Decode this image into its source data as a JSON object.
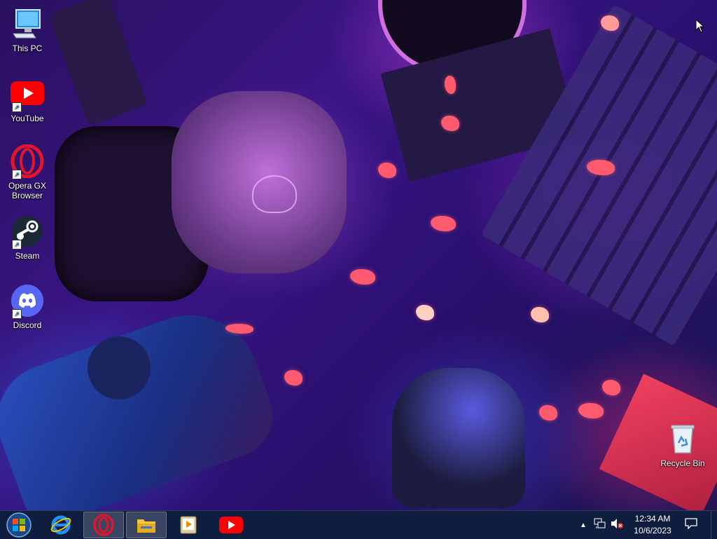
{
  "desktop": {
    "icons": [
      {
        "label": "This PC",
        "icon": "this-pc-icon"
      },
      {
        "label": "YouTube",
        "icon": "youtube-icon"
      },
      {
        "label": "Opera GX Browser",
        "icon": "opera-gx-icon"
      },
      {
        "label": "Steam",
        "icon": "steam-icon"
      },
      {
        "label": "Discord",
        "icon": "discord-icon"
      },
      {
        "label": "Recycle Bin",
        "icon": "recycle-bin-icon"
      }
    ]
  },
  "taskbar": {
    "items": [
      "start-button",
      "internet-explorer-icon",
      "opera-gx-icon",
      "file-explorer-icon",
      "media-player-icon",
      "youtube-icon"
    ],
    "time": "12:34 AM",
    "date": "10/6/2023"
  },
  "colors": {
    "taskbar": "#0f1d3f",
    "youtube_red": "#ff0000",
    "discord_blurple": "#5865f2",
    "opera_red": "#e1162c"
  }
}
